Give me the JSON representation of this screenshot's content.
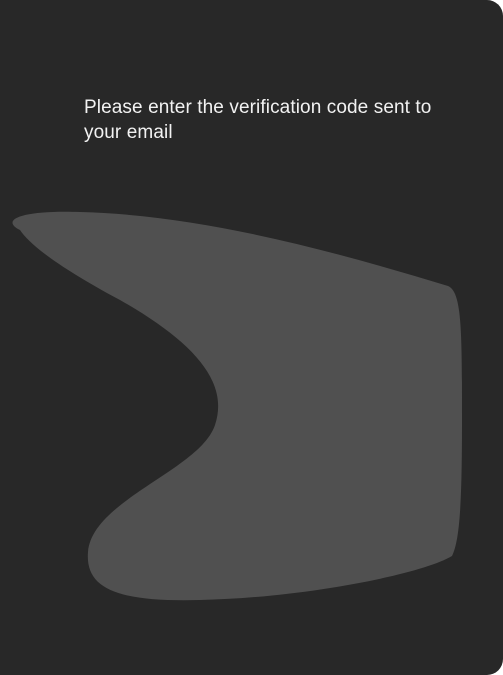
{
  "verification": {
    "prompt": "Please enter the verification code sent to your email"
  },
  "colors": {
    "panel_background": "#282828",
    "shape_fill": "#505050",
    "text": "#f2f2f2"
  },
  "icons": {
    "decorative_shape": "abstract-blob-shape"
  }
}
